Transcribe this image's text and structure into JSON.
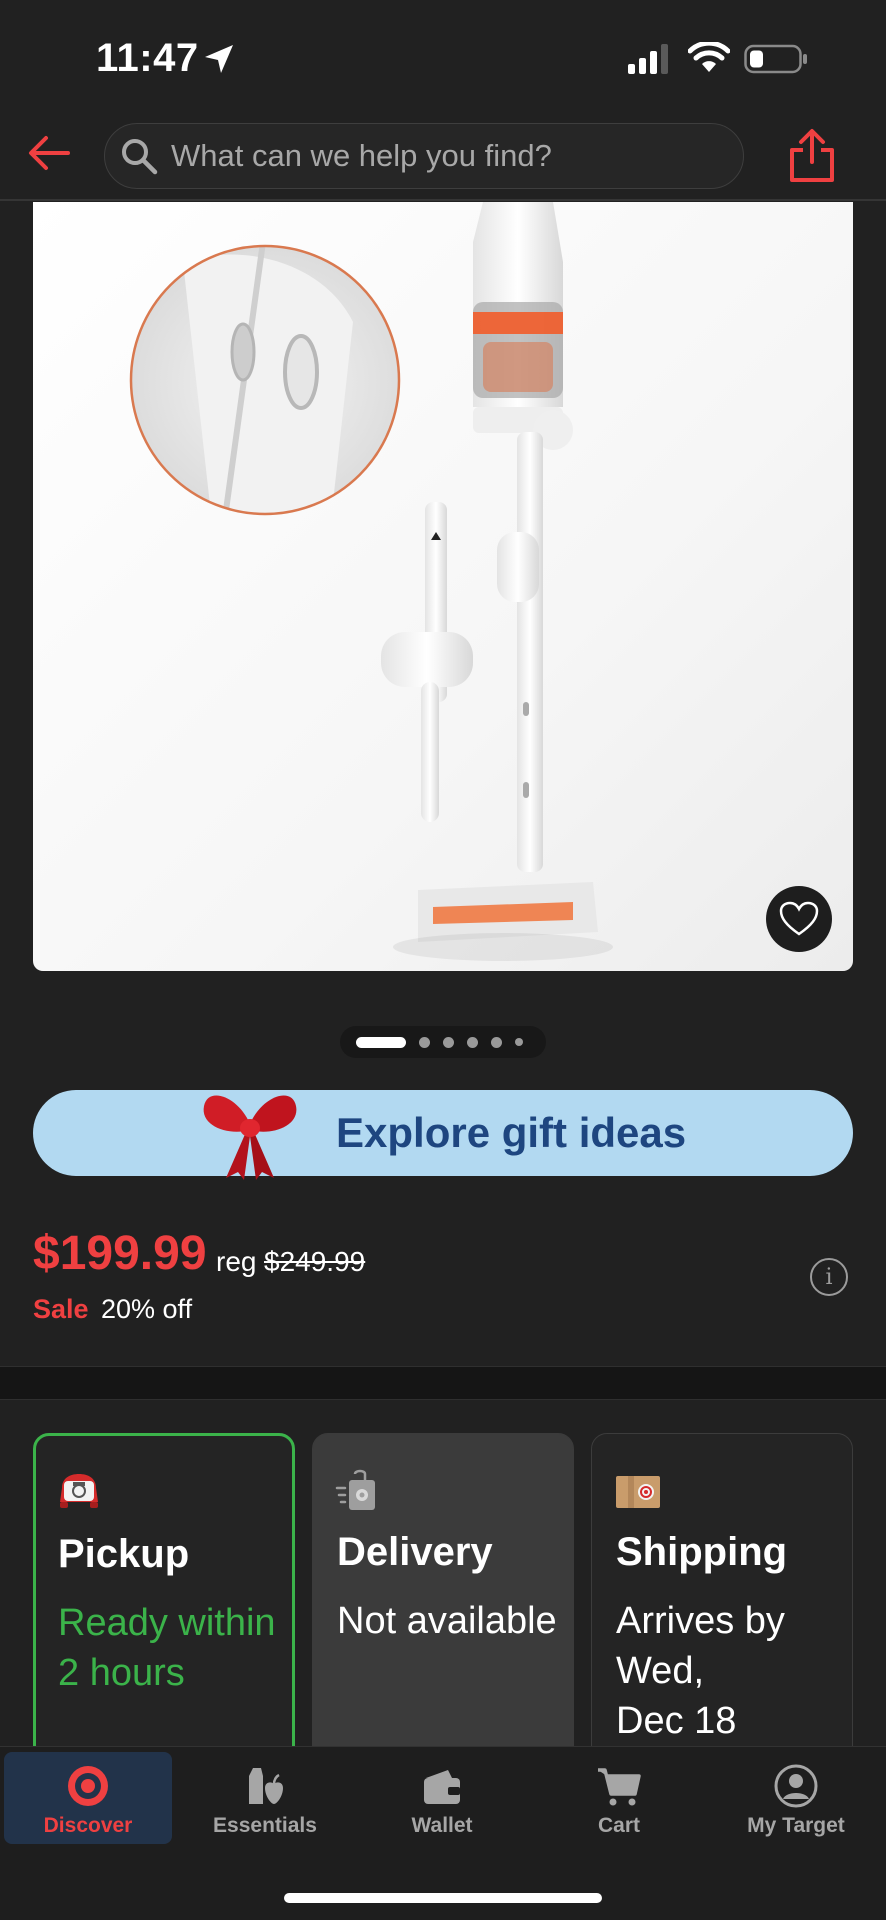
{
  "status_bar": {
    "time": "11:47"
  },
  "header": {
    "search_placeholder": "What can we help you find?"
  },
  "carousel": {
    "total_images": 6,
    "active_index": 0
  },
  "promo": {
    "gift_label": "Explore gift ideas"
  },
  "price": {
    "sale_price": "$199.99",
    "reg_word": "reg",
    "reg_price": "$249.99",
    "sale_tag": "Sale",
    "discount": "20% off",
    "info_glyph": "i"
  },
  "fulfillment": {
    "pickup": {
      "title": "Pickup",
      "detail": "Ready within 2 hours",
      "icon": "pickup-car-icon"
    },
    "delivery": {
      "title": "Delivery",
      "detail": "Not available",
      "icon": "delivery-bag-icon"
    },
    "shipping": {
      "title": "Shipping",
      "detail_line1": "Arrives by Wed,",
      "detail_line2": "Dec 18",
      "icon": "shipping-box-icon"
    }
  },
  "nav": {
    "items": [
      {
        "label": "Discover",
        "icon": "target-bullseye-icon",
        "active": true
      },
      {
        "label": "Essentials",
        "icon": "essentials-icon",
        "active": false
      },
      {
        "label": "Wallet",
        "icon": "wallet-icon",
        "active": false
      },
      {
        "label": "Cart",
        "icon": "cart-icon",
        "active": false
      },
      {
        "label": "My Target",
        "icon": "profile-icon",
        "active": false
      }
    ]
  },
  "colors": {
    "brand_red": "#ef4041",
    "pickup_green": "#3bb34a",
    "gift_banner_bg": "#b2d9f1",
    "gift_text": "#1e4680",
    "background": "#212121"
  }
}
